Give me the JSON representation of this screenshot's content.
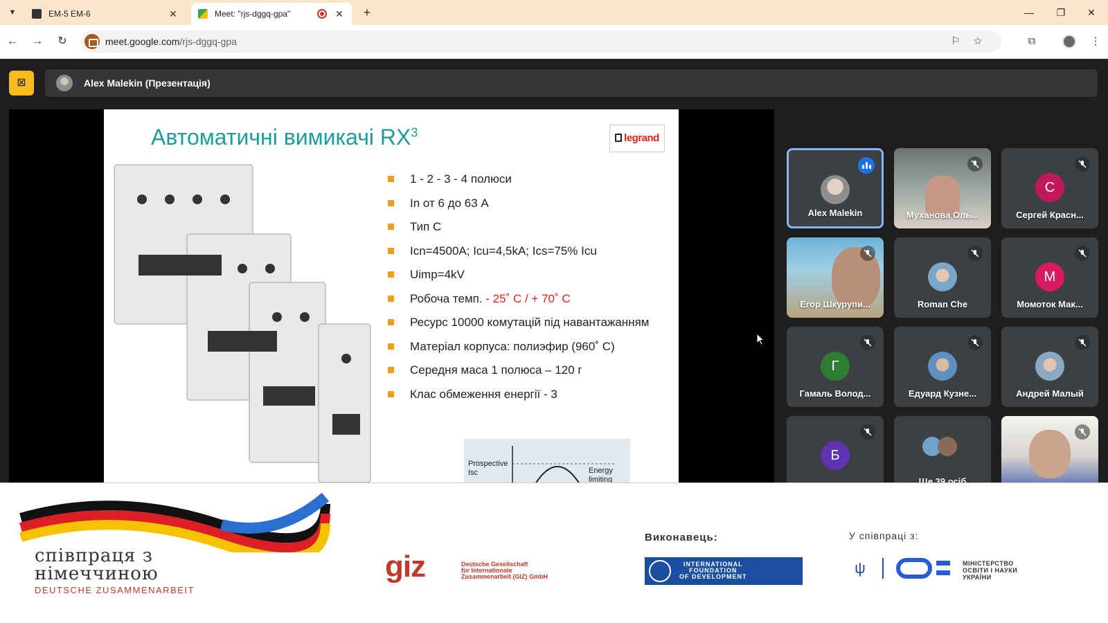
{
  "browser": {
    "tabs": [
      {
        "title": "EM-5 EM-6",
        "active": false
      },
      {
        "title": "Meet: \"rjs-dggq-gpa\"",
        "active": true
      }
    ],
    "url_host": "meet.google.com",
    "url_path": "/rjs-dggq-gpa"
  },
  "meet": {
    "presenter_label": "Alex Malekin (Презентація)",
    "participants": [
      {
        "name": "Alex Malekin",
        "initial": "",
        "speaking": true,
        "muted": false
      },
      {
        "name": "Муханова Оль...",
        "initial": "",
        "speaking": false,
        "muted": true,
        "video": true
      },
      {
        "name": "Сергей Красн...",
        "initial": "С",
        "speaking": false,
        "muted": true,
        "color": "#c2185b"
      },
      {
        "name": "Егор Шкурупи...",
        "initial": "",
        "speaking": false,
        "muted": true,
        "video": true
      },
      {
        "name": "Roman Che",
        "initial": "",
        "speaking": false,
        "muted": true
      },
      {
        "name": "Момоток Мак...",
        "initial": "М",
        "speaking": false,
        "muted": true,
        "color": "#d81b60"
      },
      {
        "name": "Гамаль Волод...",
        "initial": "Г",
        "speaking": false,
        "muted": true,
        "color": "#2e7d32"
      },
      {
        "name": "Едуард Кузне...",
        "initial": "",
        "speaking": false,
        "muted": true
      },
      {
        "name": "Андрей Малый",
        "initial": "",
        "speaking": false,
        "muted": true
      },
      {
        "name": "",
        "initial": "Б",
        "speaking": false,
        "muted": true,
        "color": "#5e35b1"
      },
      {
        "name": "Ще 39 осіб",
        "initial": "",
        "speaking": false,
        "muted": false
      },
      {
        "name": "",
        "initial": "",
        "speaking": false,
        "muted": true,
        "video": true
      }
    ]
  },
  "slide": {
    "title": "Автоматичні вимикачі RX",
    "title_sup": "3",
    "brand": "legrand",
    "bullets": [
      "1 - 2 - 3 - 4  полюси",
      "In от 6 до 63 А",
      "Тип  С",
      " Icn=4500A; Icu=4,5kA; Ics=75% Icu",
      "Uimp=4kV"
    ],
    "temp_label": "Робоча темп. ",
    "temp_value": "- 25˚  С / + 70˚  С",
    "bullets2": [
      "Ресурс 10000 комутацій під навантажанням",
      "Матеріал корпуса: полиэфир (960˚  С)",
      "Середня маса 1 полюса – 120 г",
      "Клас обмеження енергії - 3"
    ],
    "chart_label_left": "Prospective Isc",
    "chart_label_right": "Energy limiting"
  },
  "footer": {
    "coop_line1": "співпраця з",
    "coop_line2": "німеччиною",
    "coop_sub": "DEUTSCHE ZUSAMMENARBEIT",
    "giz_logo": "giz",
    "giz_text": [
      "Deutsche Gesellschaft",
      "für Internationale",
      "Zusammenarbeit (GIZ) GmbH"
    ],
    "executor_label": "Виконавець:",
    "ifd_text": [
      "INTERNATIONAL",
      "FOUNDATION",
      "OF DEVELOPMENT"
    ],
    "cooperation_label": "У співпраці з:",
    "mon_text": [
      "МІНІСТЕРСТВО",
      "ОСВІТИ І НАУКИ",
      "УКРАЇНИ"
    ]
  },
  "colors": {
    "tabbar": "#fbe6cc",
    "meet_bg": "#1e1e1e",
    "present_accent": "#f9ba1c",
    "slide_title": "#1b9c9c",
    "bullet": "#f29b1d",
    "speaking": "#1a73e8"
  }
}
